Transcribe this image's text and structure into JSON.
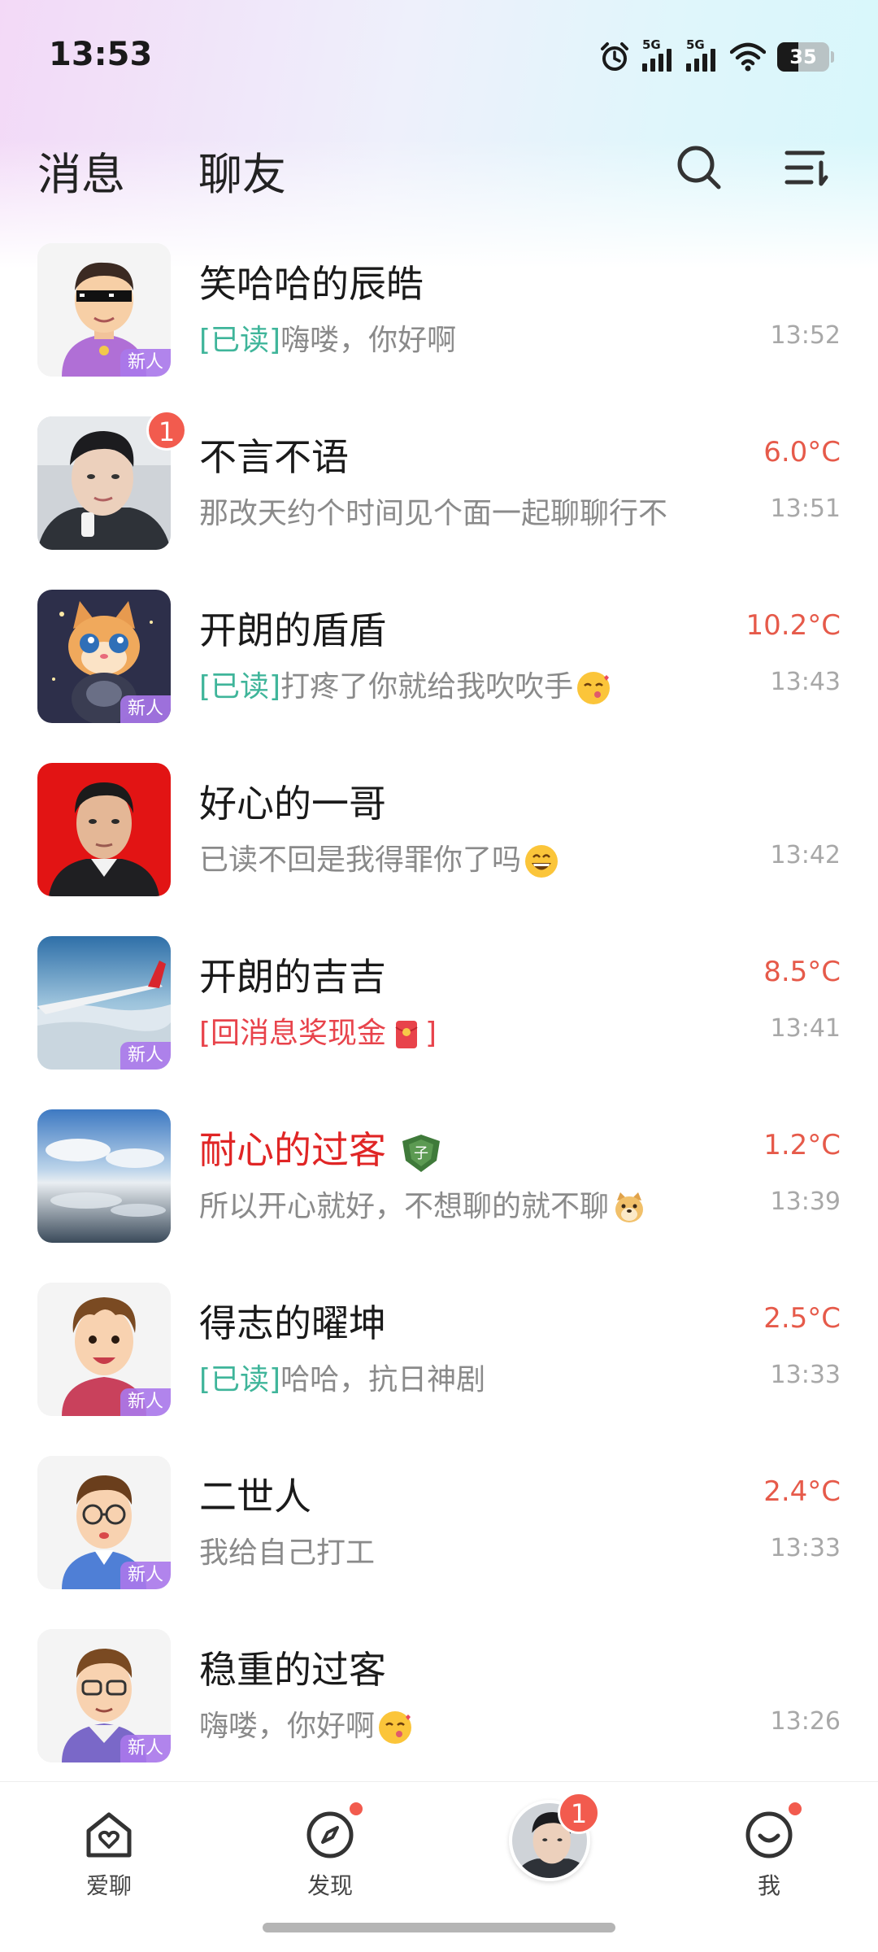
{
  "status_bar": {
    "time": "13:53",
    "signal1_label": "5G",
    "signal2_label": "5G",
    "battery": "35"
  },
  "header": {
    "tabs": [
      {
        "label": "消息"
      },
      {
        "label": "聊友"
      }
    ],
    "search_icon": "search-icon",
    "menu_icon": "sort-menu-icon"
  },
  "messages": [
    {
      "name": "笑哈哈的辰皓",
      "read": "[已读]",
      "preview": "嗨喽，你好啊",
      "temp": "",
      "time": "13:52",
      "new_tag": "新人",
      "unread": ""
    },
    {
      "name": "不言不语",
      "read": "",
      "preview": "那改天约个时间见个面一起聊聊行不",
      "temp": "6.0°C",
      "time": "13:51",
      "new_tag": "",
      "unread": "1"
    },
    {
      "name": "开朗的盾盾",
      "read": "[已读]",
      "preview": "打疼了你就给我吹吹手",
      "temp": "10.2°C",
      "time": "13:43",
      "new_tag": "新人",
      "unread": ""
    },
    {
      "name": "好心的一哥",
      "read": "",
      "preview": "已读不回是我得罪你了吗",
      "temp": "",
      "time": "13:42",
      "new_tag": "",
      "unread": ""
    },
    {
      "name": "开朗的吉吉",
      "read": "",
      "preview": "[回消息奖现金",
      "preview_end": "]",
      "temp": "8.5°C",
      "time": "13:41",
      "new_tag": "新人",
      "unread": ""
    },
    {
      "name": "耐心的过客",
      "read": "",
      "preview": "所以开心就好，不想聊的就不聊",
      "temp": "1.2°C",
      "time": "13:39",
      "new_tag": "",
      "unread": "",
      "shield_text": "子"
    },
    {
      "name": "得志的曜坤",
      "read": "[已读]",
      "preview": "哈哈，抗日神剧",
      "temp": "2.5°C",
      "time": "13:33",
      "new_tag": "新人",
      "unread": ""
    },
    {
      "name": "二世人",
      "read": "",
      "preview": "我给自己打工",
      "temp": "2.4°C",
      "time": "13:33",
      "new_tag": "新人",
      "unread": ""
    },
    {
      "name": "稳重的过客",
      "read": "",
      "preview": "嗨喽，你好啊",
      "temp": "",
      "time": "13:26",
      "new_tag": "新人",
      "unread": ""
    }
  ],
  "bottom_nav": {
    "items": [
      {
        "label": "爱聊"
      },
      {
        "label": "发现"
      },
      {
        "label": "我"
      }
    ],
    "center_badge": "1"
  },
  "colors": {
    "accent": "#9d5cf0",
    "read": "#3fb59a",
    "temp": "#e65a4a",
    "badge": "#f25b4e",
    "highlight_name": "#e02525"
  }
}
